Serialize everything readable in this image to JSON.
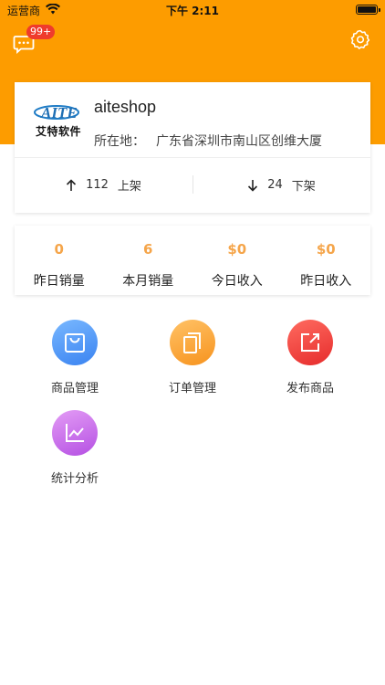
{
  "status_bar": {
    "carrier": "运营商",
    "time": "下午 2:11"
  },
  "header": {
    "message_badge": "99+",
    "message_icon": "chat-bubble-icon",
    "settings_icon": "gear-icon",
    "color": "#fd9c00"
  },
  "profile": {
    "logo_text": "艾特软件",
    "shop_name": "aiteshop",
    "location_label": "所在地：",
    "location_value": "广东省深圳市南山区创维大厦",
    "on_shelf_count": "112",
    "on_shelf_label": "上架",
    "off_shelf_count": "24",
    "off_shelf_label": "下架"
  },
  "sales": [
    {
      "value": "0",
      "label": "昨日销量"
    },
    {
      "value": "6",
      "label": "本月销量"
    },
    {
      "value": "$0",
      "label": "今日收入"
    },
    {
      "value": "$0",
      "label": "昨日收入"
    }
  ],
  "functions": [
    {
      "label": "商品管理",
      "icon": "shopping-bag-icon",
      "color": "#4a90f0"
    },
    {
      "label": "订单管理",
      "icon": "documents-icon",
      "color": "#f7931e"
    },
    {
      "label": "发布商品",
      "icon": "external-link-icon",
      "color": "#e62c2c"
    },
    {
      "label": "统计分析",
      "icon": "line-chart-icon",
      "color": "#b550e3"
    }
  ]
}
